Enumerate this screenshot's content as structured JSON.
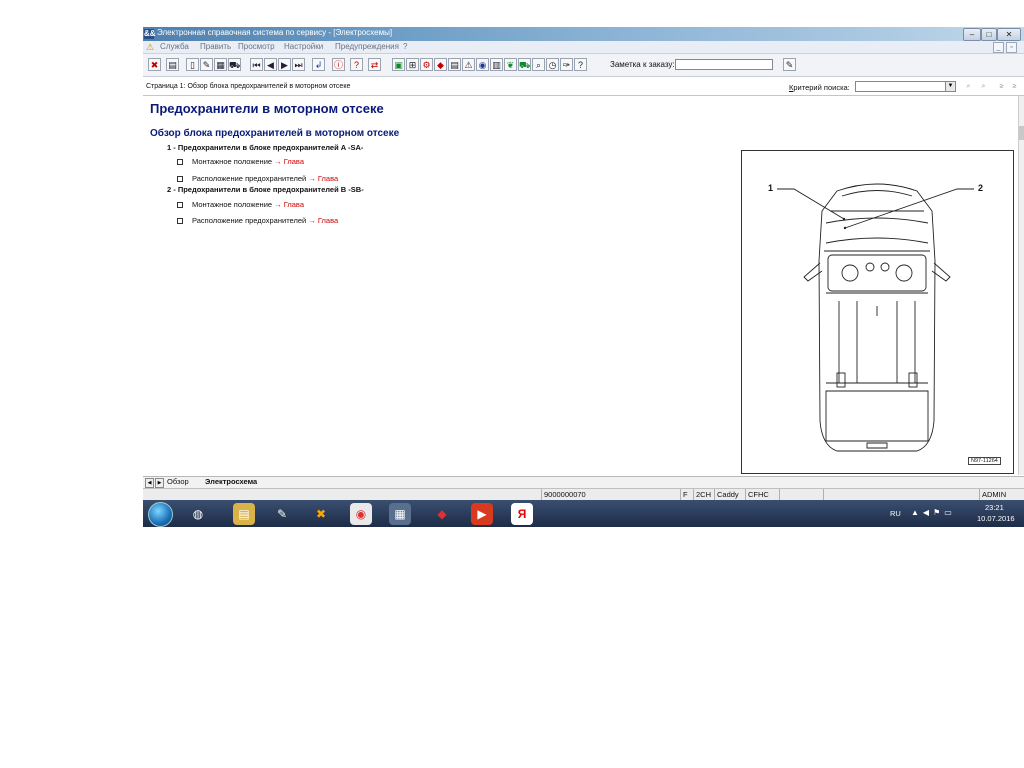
{
  "window": {
    "title": "Электронная справочная система по сервису - [Электросхемы]",
    "app_icon_text": "&&"
  },
  "menu": {
    "items": [
      "Служба",
      "Править",
      "Просмотр",
      "Настройки",
      "Предупреждения",
      "?"
    ]
  },
  "toolbar": {
    "note_label": "Заметка к заказу:",
    "note_value": ""
  },
  "pagebar": {
    "page_label": "Страница 1: Обзор блока предохранителей в моторном отсеке",
    "search_label_accesskey": "К",
    "search_label_rest": "ритерий поиска:",
    "search_value": ""
  },
  "document": {
    "title": "Предохранители в моторном отсеке",
    "subtitle": "Обзор блока предохранителей в моторном отсеке",
    "items": [
      {
        "label": "1 - Предохранители в блоке предохранителей A -SA-",
        "subs": [
          {
            "text": "Монтажное положение",
            "link": "→ Глава"
          },
          {
            "text": "Расположение предохранителей",
            "link": "→ Глава"
          }
        ]
      },
      {
        "label": "2 - Предохранители в блоке предохранителей B -SB-",
        "subs": [
          {
            "text": "Монтажное положение",
            "link": "→ Глава"
          },
          {
            "text": "Расположение предохранителей",
            "link": "→ Глава"
          }
        ]
      }
    ],
    "figure": {
      "callout_1": "1",
      "callout_2": "2",
      "code": "N97-11264"
    }
  },
  "tabs": {
    "overview": "Обзор",
    "schema": "Электросхема"
  },
  "status": {
    "number": "9000000070",
    "f": "F",
    "code1": "2CH",
    "model": "Caddy",
    "engine": "CFHC",
    "user": "ADMIN"
  },
  "taskbar": {
    "lang": "RU",
    "time": "23:21",
    "date": "10.07.2016"
  }
}
